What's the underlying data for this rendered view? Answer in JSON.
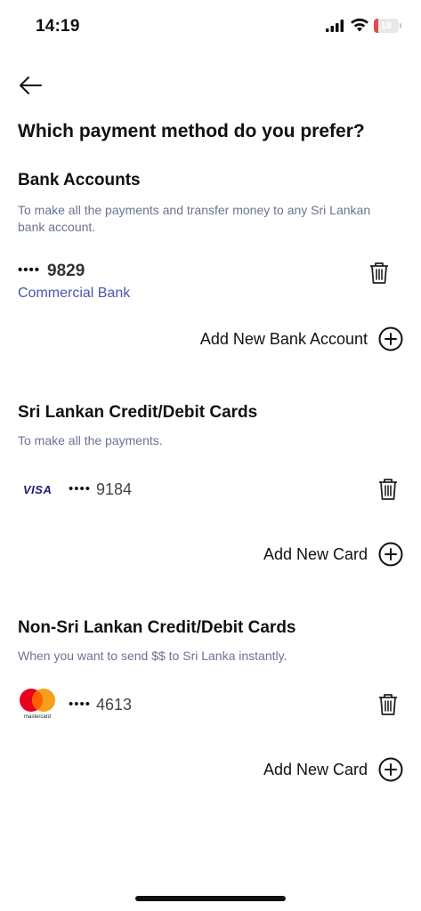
{
  "status_bar": {
    "time": "14:19",
    "battery_level": "18"
  },
  "page": {
    "title": "Which payment method do you prefer?"
  },
  "bank_accounts": {
    "title": "Bank Accounts",
    "description": "To make all the payments and transfer money to any Sri Lankan bank account.",
    "items": [
      {
        "masked": "••••",
        "last4": "9829",
        "bank_name": "Commercial Bank"
      }
    ],
    "add_label": "Add New Bank Account"
  },
  "local_cards": {
    "title": "Sri Lankan Credit/Debit Cards",
    "description": "To make all the payments.",
    "items": [
      {
        "brand": "VISA",
        "masked": "••••",
        "last4": "9184"
      }
    ],
    "add_label": "Add New Card"
  },
  "foreign_cards": {
    "title": "Non-Sri Lankan Credit/Debit Cards",
    "description": "When you want to send $$ to Sri Lanka instantly.",
    "items": [
      {
        "brand": "mastercard",
        "masked": "••••",
        "last4": "4613"
      }
    ],
    "add_label": "Add New Card"
  },
  "colors": {
    "link_blue": "#4a56b0",
    "description_gray": "#6b7393",
    "battery_red": "#e5484d",
    "mastercard_red": "#eb001b",
    "mastercard_orange": "#f79e1b",
    "visa_blue": "#1a1f71"
  },
  "icons": {
    "back": "arrow-left-icon",
    "delete": "trash-icon",
    "add": "plus-circle-icon"
  }
}
